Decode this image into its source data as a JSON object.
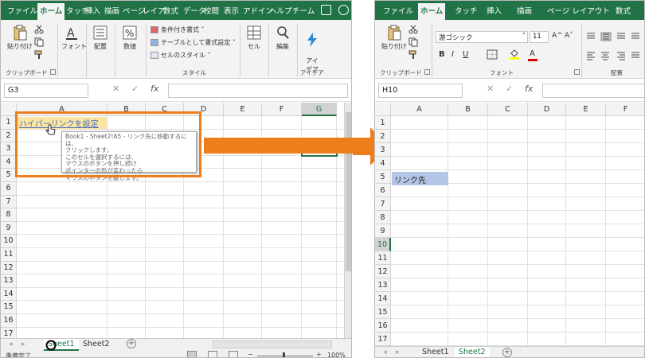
{
  "left_window": {
    "tabs": [
      "ファイル",
      "ホーム",
      "タッチ",
      "挿入",
      "描画",
      "ページ",
      "レイア",
      "数式",
      "データ",
      "校閲",
      "表示",
      "アドイン",
      "ヘルプ",
      "チーム"
    ],
    "active_tab": "ホーム",
    "ribbon": {
      "paste": "貼り付け",
      "font": "フォント",
      "align": "配置",
      "number": "数値",
      "conditional_format": "条件付き書式",
      "table_format": "テーブルとして書式設定",
      "cell_style": "セルのスタイル",
      "cells": "セル",
      "edit": "編集",
      "ideas": "アイ\nデア",
      "group_clipboard": "クリップボード",
      "group_style": "スタイル",
      "group_ideas": "アイデア"
    },
    "name_box": "G3",
    "columns": [
      "A",
      "B",
      "C",
      "D",
      "E",
      "F",
      "G"
    ],
    "selected_column": "G",
    "rows": [
      "1",
      "2",
      "3",
      "4",
      "5",
      "6",
      "7",
      "8",
      "9",
      "10",
      "11",
      "12",
      "13",
      "14",
      "15",
      "16",
      "17"
    ],
    "hyperlink_text": "ハイパーリンクを設定",
    "tooltip_lines": [
      "Book1 - Sheet2!A5 - リンク先に移動するには、",
      "クリックします。",
      "このセルを選択するには、",
      "マウスのボタンを押し続け",
      "ポインターの形が変わったら",
      "マウスのボタンを離します。"
    ],
    "sheets": [
      "Sheet1",
      "Sheet2"
    ],
    "active_sheet": "Sheet1",
    "status": "準備完了",
    "zoom": "100%"
  },
  "right_window": {
    "tabs": [
      "ファイル",
      "ホーム",
      "タッチ",
      "挿入",
      "描画",
      "ページ レイアウト",
      "数式"
    ],
    "active_tab": "ホーム",
    "ribbon": {
      "paste": "貼り付け",
      "font_name": "游ゴシック",
      "font_size": "11",
      "bold": "B",
      "italic": "I",
      "underline": "U",
      "grow": "A^",
      "shrink": "Aˇ",
      "font_color": "A",
      "group_clipboard": "クリップボード",
      "group_font": "フォント",
      "group_align": "配置"
    },
    "name_box": "H10",
    "columns": [
      "A",
      "B",
      "C",
      "D",
      "E",
      "F"
    ],
    "rows": [
      "1",
      "2",
      "3",
      "4",
      "5",
      "6",
      "7",
      "8",
      "9",
      "10",
      "11",
      "12",
      "13",
      "14",
      "15",
      "16",
      "17"
    ],
    "selected_row": "10",
    "link_target_text": "リンク先",
    "sheets": [
      "Sheet1",
      "Sheet2"
    ],
    "active_sheet": "Sheet2"
  },
  "colors": {
    "excel_green": "#217346",
    "arrow_orange": "#ee7d1b",
    "highlight_box": "#ee7d1b",
    "target_cell": "#b4c6e7"
  }
}
